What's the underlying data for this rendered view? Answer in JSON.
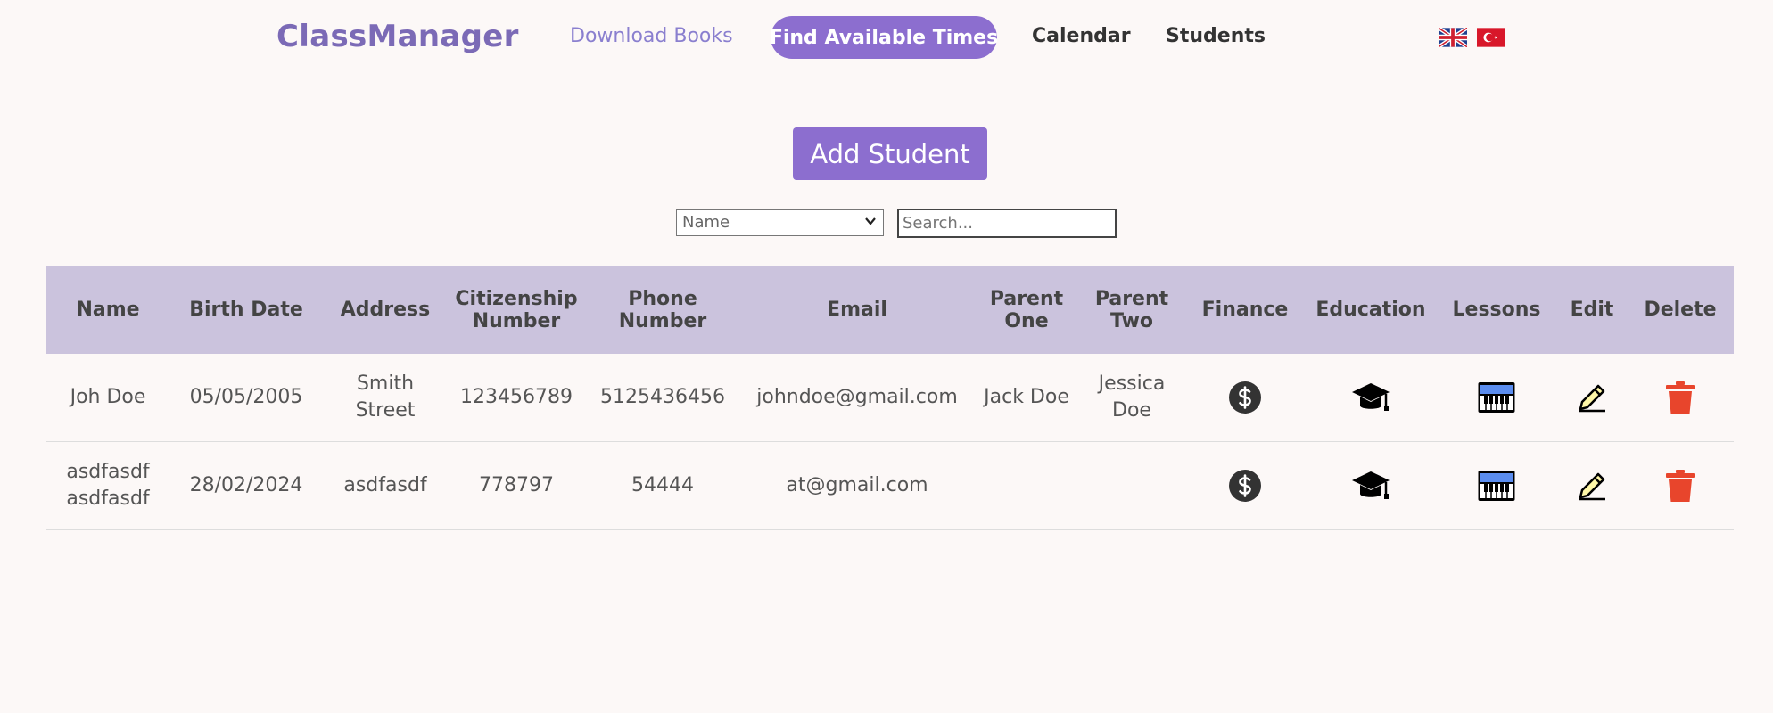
{
  "nav": {
    "brand": "ClassManager",
    "links": {
      "download_books": "Download Books",
      "find_available_times": "Find Available Times",
      "calendar": "Calendar",
      "students": "Students"
    },
    "languages": [
      "english-flag-icon",
      "turkish-flag-icon"
    ]
  },
  "actions": {
    "add_student": "Add Student"
  },
  "filter": {
    "selected_field": "Name",
    "search_placeholder": "Search..."
  },
  "table": {
    "headers": {
      "name": "Name",
      "birth_date": "Birth Date",
      "address": "Address",
      "citizenship_number": "Citizenship Number",
      "phone_number": "Phone Number",
      "email": "Email",
      "parent_one": "Parent One",
      "parent_two": "Parent Two",
      "finance": "Finance",
      "education": "Education",
      "lessons": "Lessons",
      "edit": "Edit",
      "delete": "Delete"
    },
    "rows": [
      {
        "name": "Joh Doe",
        "birth_date": "05/05/2005",
        "address": "Smith Street",
        "citizenship_number": "123456789",
        "phone_number": "5125436456",
        "email": "johndoe@gmail.com",
        "parent_one": "Jack Doe",
        "parent_two": "Jessica Doe"
      },
      {
        "name": "asdfasdf asdfasdf",
        "birth_date": "28/02/2024",
        "address": "asdfasdf",
        "citizenship_number": "778797",
        "phone_number": "54444",
        "email": "at@gmail.com",
        "parent_one": "",
        "parent_two": ""
      }
    ]
  },
  "icons": {
    "finance": "dollar-icon",
    "education": "graduation-cap-icon",
    "lessons": "piano-icon",
    "edit": "pencil-icon",
    "delete": "trash-icon"
  },
  "colors": {
    "brand": "#7b6ab6",
    "accent": "#8c6ecf",
    "header_bg": "#cbc3dd",
    "delete": "#e8452c",
    "page_bg": "#fcf8f7"
  }
}
